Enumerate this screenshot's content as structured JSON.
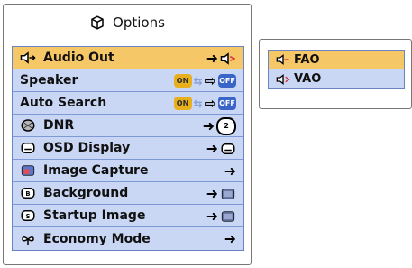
{
  "main_panel": {
    "title": "Options",
    "items": [
      {
        "label": "Audio Out",
        "selected": true,
        "left_icon": "audio-out-icon",
        "right_icon": "audio-out-right-icon"
      },
      {
        "label": "Speaker",
        "selected": false,
        "left_icon": "",
        "right_icon": "toggle-on-to-off"
      },
      {
        "label": "Auto Search",
        "selected": false,
        "left_icon": "",
        "right_icon": "toggle-on-to-off"
      },
      {
        "label": "DNR",
        "selected": false,
        "left_icon": "dnr-icon",
        "right_icon": "dnr-level-2-icon",
        "right_value": "2"
      },
      {
        "label": "OSD Display",
        "selected": false,
        "left_icon": "osd-display-icon",
        "right_icon": "osd-display-icon"
      },
      {
        "label": "Image Capture",
        "selected": false,
        "left_icon": "image-capture-icon",
        "right_icon": ""
      },
      {
        "label": "Background",
        "selected": false,
        "left_icon": "background-icon",
        "right_icon": "background-setting-icon"
      },
      {
        "label": "Startup Image",
        "selected": false,
        "left_icon": "startup-image-icon",
        "right_icon": "startup-image-setting-icon"
      },
      {
        "label": "Economy Mode",
        "selected": false,
        "left_icon": "economy-mode-icon",
        "right_icon": ""
      }
    ],
    "toggle": {
      "on": "ON",
      "off": "OFF"
    }
  },
  "submenu": {
    "items": [
      {
        "label": "FAO",
        "selected": true,
        "icon": "fao-icon"
      },
      {
        "label": "VAO",
        "selected": false,
        "icon": "vao-icon"
      }
    ]
  }
}
